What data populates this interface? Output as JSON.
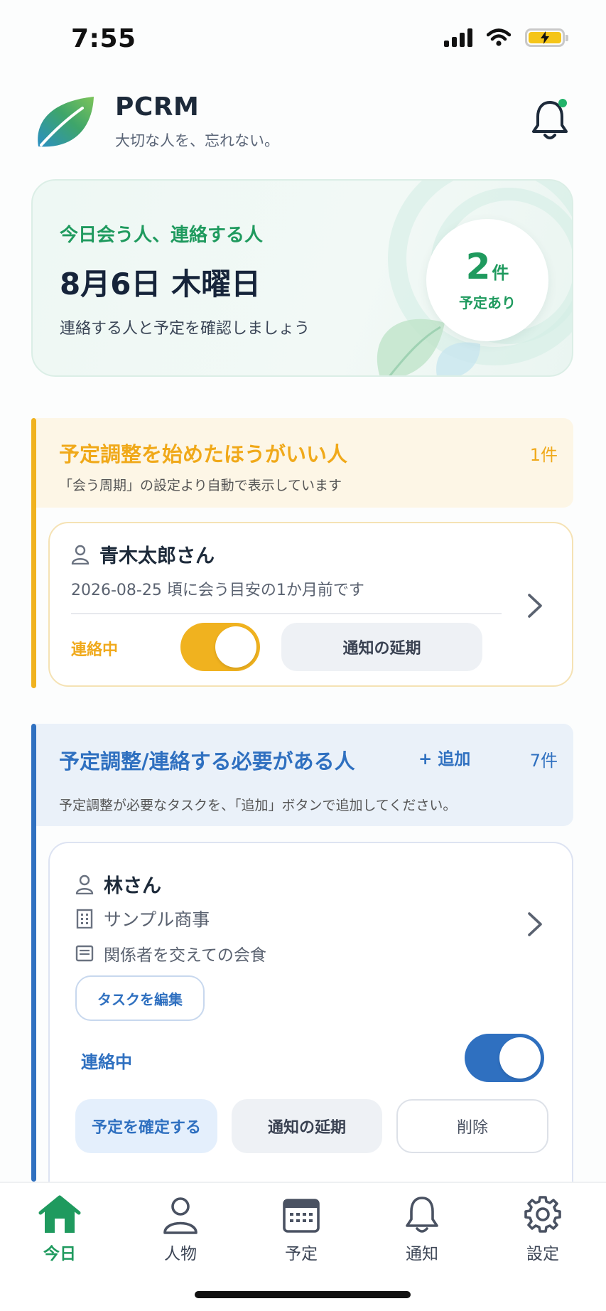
{
  "status_bar": {
    "time": "7:55"
  },
  "header": {
    "title": "PCRM",
    "subtitle": "大切な人を、忘れない。",
    "icons": [
      "leaf-logo",
      "bell-icon"
    ]
  },
  "today": {
    "eyebrow": "今日会う人、連絡する人",
    "date": "8月6日 木曜日",
    "description": "連絡する人と予定を確認しましょう",
    "count": "2",
    "count_unit": "件",
    "count_label": "予定あり"
  },
  "suggest_section": {
    "title": "予定調整を始めたほうがいい人",
    "count": "1件",
    "note": "「会う周期」の設定より自動で表示しています",
    "card": {
      "name": "青木太郎さん",
      "detail": "2026-08-25 頃に会う目安の1か月前です",
      "status_label": "連絡中",
      "toggle_on": true,
      "snooze_label": "通知の延期"
    }
  },
  "tasks_section": {
    "title": "予定調整/連絡する必要がある人",
    "add_label": "+ 追加",
    "count": "7件",
    "note": "予定調整が必要なタスクを、「追加」ボタンで追加してください。",
    "card": {
      "name": "林さん",
      "company": "サンプル商事",
      "task": "関係者を交えての会食",
      "edit_label": "タスクを編集",
      "status_label": "連絡中",
      "toggle_on": true,
      "confirm_label": "予定を確定する",
      "snooze_label": "通知の延期",
      "delete_label": "削除"
    }
  },
  "tab_bar": {
    "active": "今日",
    "tabs": [
      {
        "label": "今日",
        "icon": "home-icon"
      },
      {
        "label": "人物",
        "icon": "person-icon"
      },
      {
        "label": "予定",
        "icon": "calendar-icon"
      },
      {
        "label": "通知",
        "icon": "bell-icon"
      },
      {
        "label": "設定",
        "icon": "gear-icon"
      }
    ]
  },
  "colors": {
    "green": "#1f9a5e",
    "amber": "#f0b21f",
    "blue": "#2f70c0",
    "navy": "#16243a"
  }
}
